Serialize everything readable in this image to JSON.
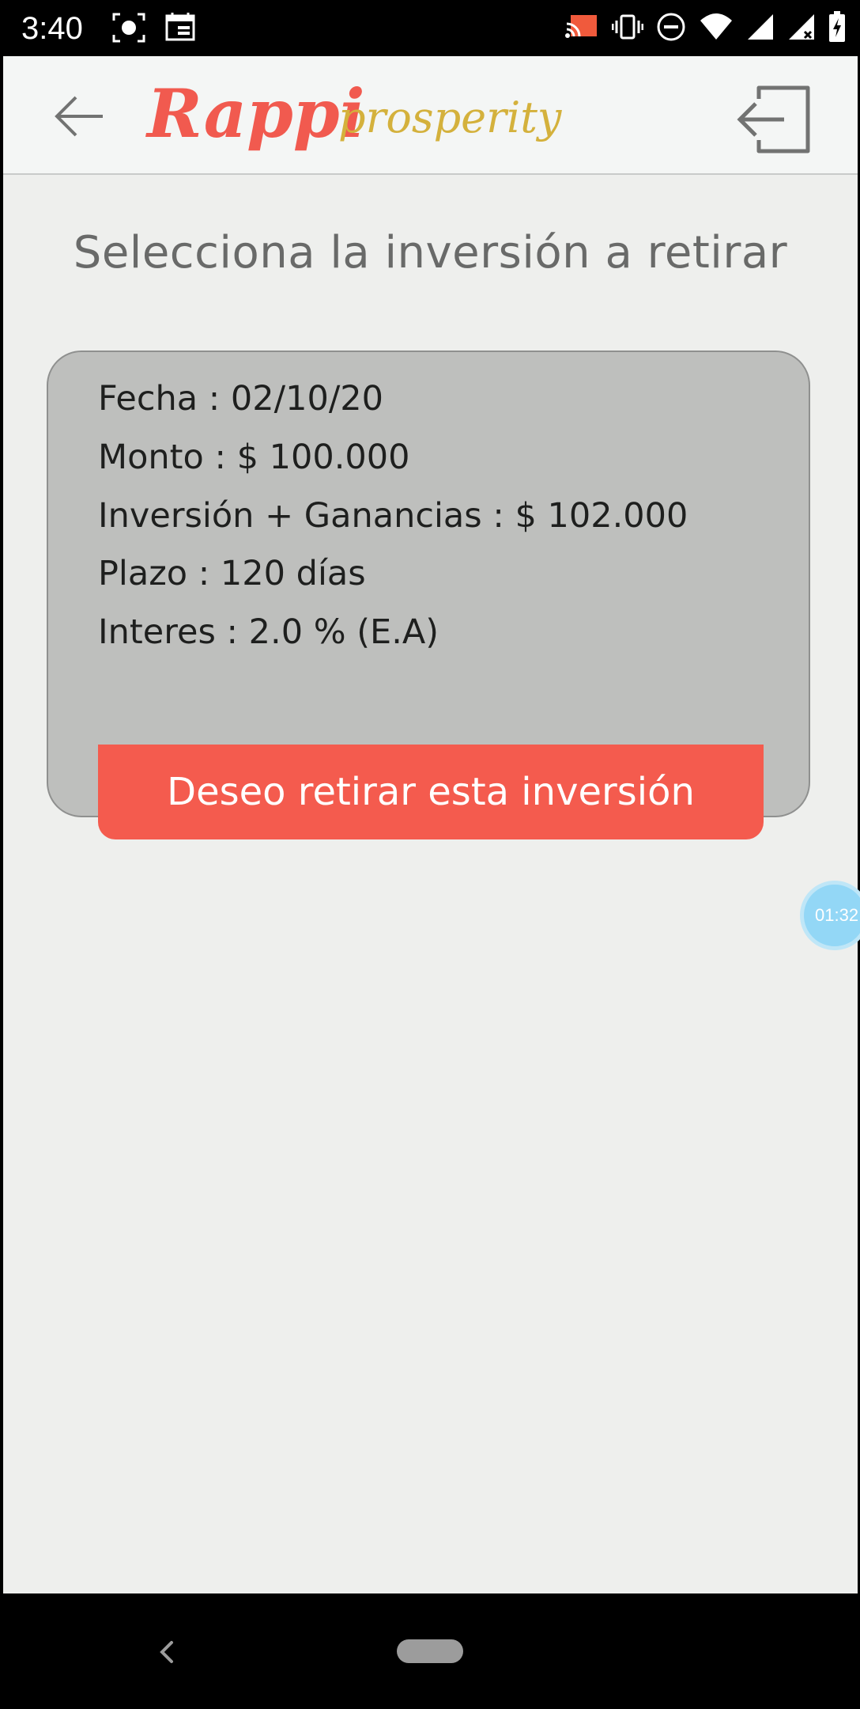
{
  "status_bar": {
    "time": "3:40",
    "left_icons": [
      "screenshot-icon",
      "calendar-icon"
    ],
    "right_icons": [
      "cast-icon",
      "vibrate-icon",
      "do-not-disturb-icon",
      "wifi-icon",
      "signal-icon",
      "battery-charging-icon"
    ]
  },
  "header": {
    "logo_primary": "Rappi",
    "logo_secondary": "prosperity",
    "logo_primary_color": "#f15a4f",
    "logo_secondary_color": "#d4b13c",
    "back_icon": "arrow-left-icon",
    "logout_icon": "logout-icon"
  },
  "main": {
    "title": "Selecciona la inversión a retirar",
    "investment": {
      "fecha": "Fecha : 02/10/20",
      "monto": "Monto : $ 100.000",
      "inversion_ganancias": "Inversión + Ganancias : $ 102.000",
      "plazo": "Plazo : 120 días",
      "interes": "Interes : 2.0 % (E.A)",
      "button_label": "Deseo retirar esta inversión",
      "button_color": "#f45b4e"
    }
  },
  "overlay": {
    "timer": "01:32"
  },
  "nav_bar": {
    "back_icon": "nav-back-icon",
    "home_icon": "nav-home-pill"
  }
}
